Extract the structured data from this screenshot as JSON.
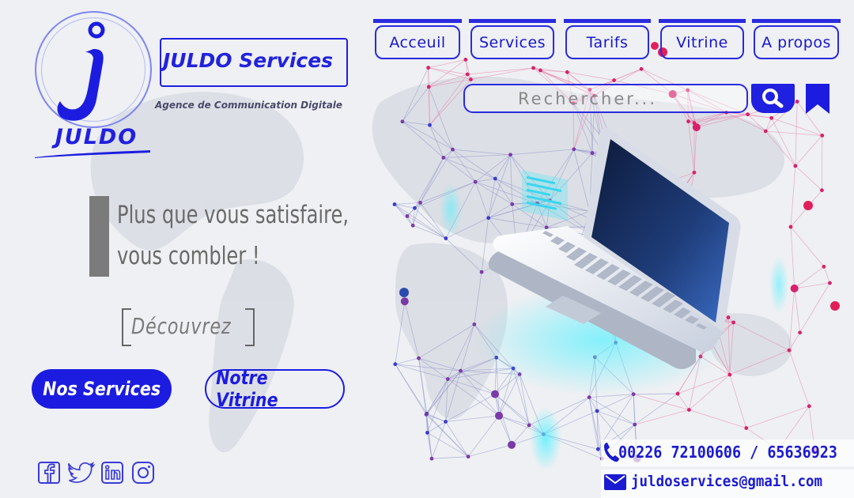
{
  "brand": {
    "logo_word": "JULDO",
    "name": "JULDO Services",
    "tagline": "Agence de Communication Digitale"
  },
  "nav": {
    "items": [
      {
        "label": "Acceuil"
      },
      {
        "label": "Services"
      },
      {
        "label": "Tarifs"
      },
      {
        "label": "Vitrine"
      },
      {
        "label": "A propos"
      }
    ]
  },
  "search": {
    "placeholder": "Rechercher...",
    "icon": "search-icon"
  },
  "hero": {
    "line1": "Plus que vous satisfaire,",
    "line2": "vous combler !",
    "discover": "Découvrez"
  },
  "cta": {
    "services_label": "Nos Services",
    "vitrine_label": "Notre Vitrine"
  },
  "social": [
    "facebook-icon",
    "twitter-icon",
    "linkedin-icon",
    "instagram-icon"
  ],
  "contact": {
    "phone": "00226 72100606 / 65636923",
    "email": "juldoservices@gmail.com"
  },
  "colors": {
    "primary": "#2020e0",
    "text_gray": "#6a6a6a",
    "accent_pink": "#e0206a",
    "accent_cyan": "#3ee8f0"
  }
}
